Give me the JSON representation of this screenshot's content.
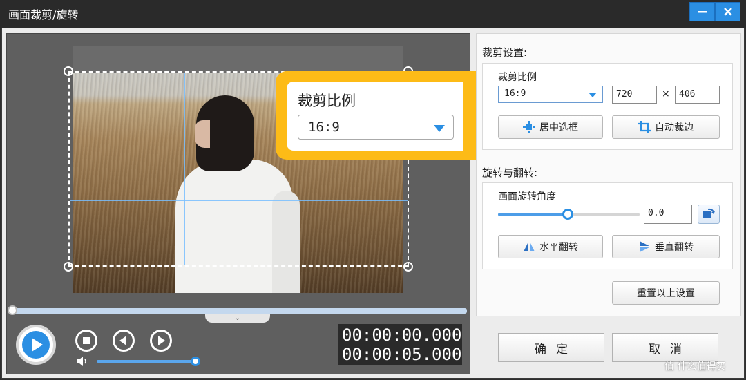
{
  "window": {
    "title": "画面裁剪/旋转",
    "minimize_icon": "minimize-icon",
    "close_icon": "close-icon"
  },
  "callout": {
    "label": "裁剪比例",
    "value": "16:9"
  },
  "player": {
    "time_current": "00:00:00.000",
    "time_total": "00:00:05.000",
    "seek_progress": 0.0,
    "volume_level": 1.0,
    "expand_glyph": "⌄"
  },
  "crop": {
    "section_title": "裁剪设置:",
    "ratio_label": "裁剪比例",
    "ratio_value": "16:9",
    "width_value": "720",
    "times_symbol": "×",
    "height_value": "406",
    "center_button": "居中选框",
    "auto_button": "自动裁边"
  },
  "rotate": {
    "section_title": "旋转与翻转:",
    "angle_label": "画面旋转角度",
    "angle_value": "0.0",
    "slider_level": 0.5,
    "flip_h_button": "水平翻转",
    "flip_v_button": "垂直翻转"
  },
  "reset_button": "重置以上设置",
  "footer": {
    "ok_button": "确定",
    "cancel_button": "取消"
  },
  "watermark": "值 什么值得买",
  "colors": {
    "accent": "#2b8fe3",
    "callout": "#fdbb17",
    "titlebar": "#2a2a2a"
  }
}
